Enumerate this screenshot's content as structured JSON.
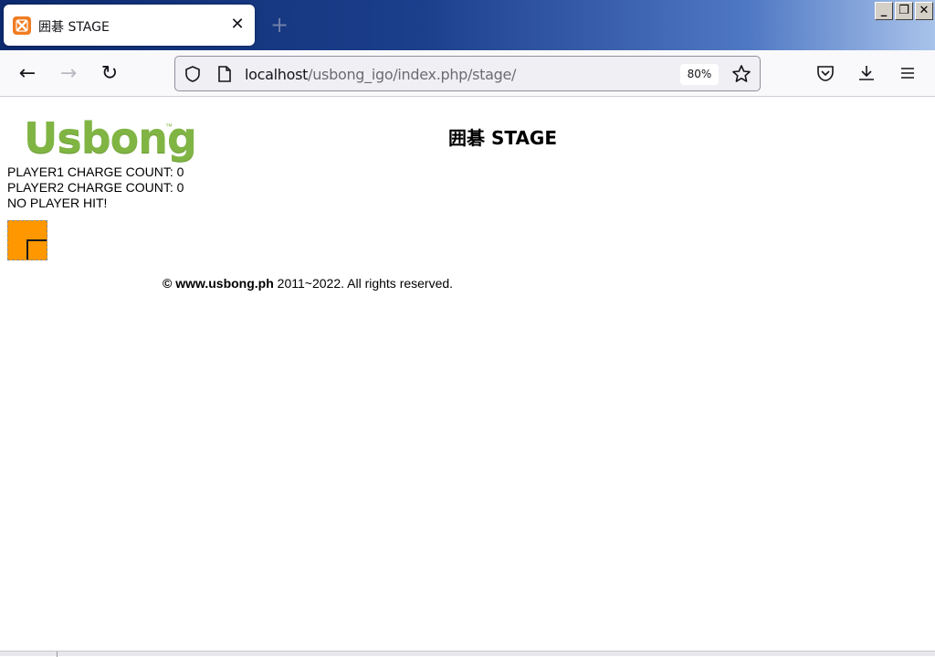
{
  "browser": {
    "tab": {
      "title": "囲碁 STAGE",
      "close_glyph": "✕",
      "favicon": "xampp-icon"
    },
    "new_tab_glyph": "+",
    "window_controls": {
      "minimize": "_",
      "restore": "❐",
      "close": "✕"
    },
    "nav": {
      "back_glyph": "←",
      "forward_glyph": "→",
      "reload_glyph": "↻"
    },
    "url": {
      "host": "localhost",
      "path": "/usbong_igo/index.php/stage/"
    },
    "zoom": "80%"
  },
  "page": {
    "logo_text": "Usbong",
    "logo_tm": "™",
    "title": "囲碁 STAGE",
    "status": {
      "player1": "PLAYER1 CHARGE COUNT: 0",
      "player2": "PLAYER2 CHARGE COUNT: 0",
      "hit": "NO PLAYER HIT!"
    },
    "footer": {
      "copyright": "© www.usbong.ph",
      "rest": " 2011~2022. All rights reserved."
    }
  },
  "colors": {
    "logo_green": "#80b544",
    "tile_orange": "#ff9800",
    "titlebar_blue": "#1c3f8c"
  }
}
